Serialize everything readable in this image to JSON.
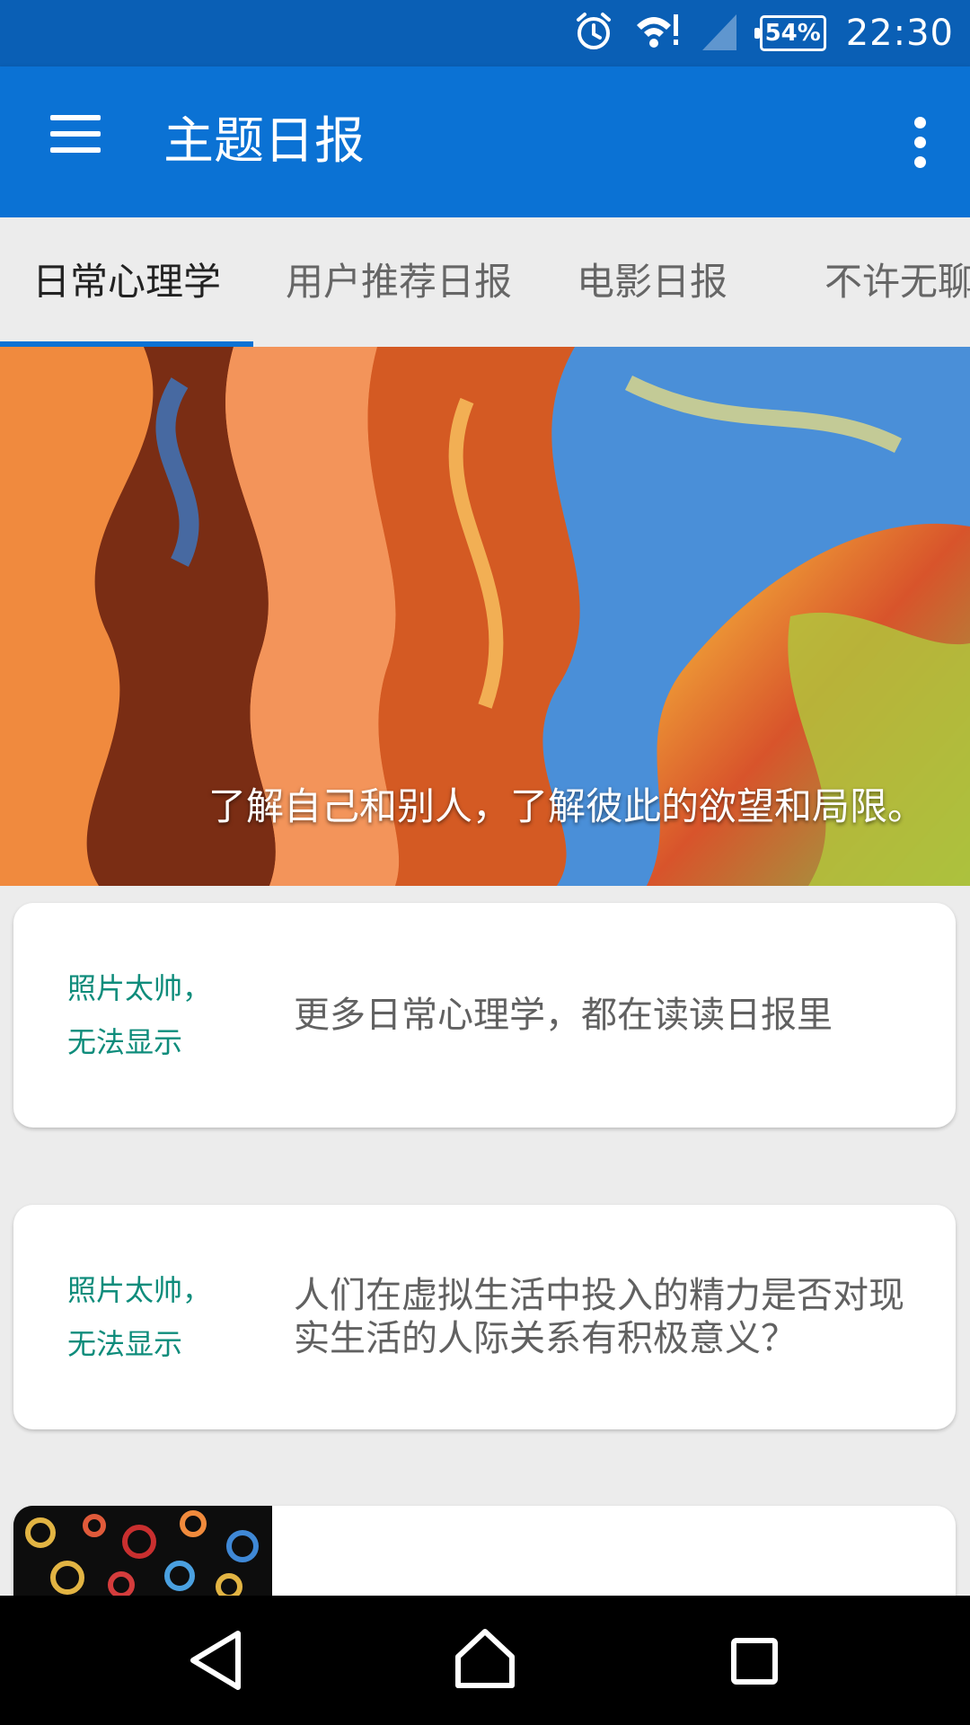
{
  "status_bar": {
    "battery": "54%",
    "time": "22:30",
    "icons": [
      "alarm-icon",
      "wifi-icon",
      "signal-icon",
      "battery-icon"
    ]
  },
  "app_bar": {
    "title": "主题日报",
    "menu_icon": "hamburger-menu-icon",
    "overflow_icon": "more-vertical-icon",
    "color": "#0b72d4"
  },
  "tabs": [
    {
      "label": "日常心理学",
      "active": true
    },
    {
      "label": "用户推荐日报",
      "active": false
    },
    {
      "label": "电影日报",
      "active": false
    },
    {
      "label": "不许无聊",
      "active": false
    }
  ],
  "hero": {
    "caption": "了解自己和别人，了解彼此的欲望和局限。"
  },
  "stories": [
    {
      "image_fallback_line1": "照片太帅，",
      "image_fallback_line2": "无法显示",
      "title": "更多日常心理学，都在读读日报里"
    },
    {
      "image_fallback_line1": "照片太帅，",
      "image_fallback_line2": "无法显示",
      "title": "人们在虚拟生活中投入的精力是否对现实生活的人际关系有积极意义？"
    },
    {
      "image": "gears-image",
      "title": ""
    }
  ],
  "nav_bar": {
    "back_icon": "back-triangle-icon",
    "home_icon": "home-icon",
    "recents_icon": "recents-square-icon"
  }
}
